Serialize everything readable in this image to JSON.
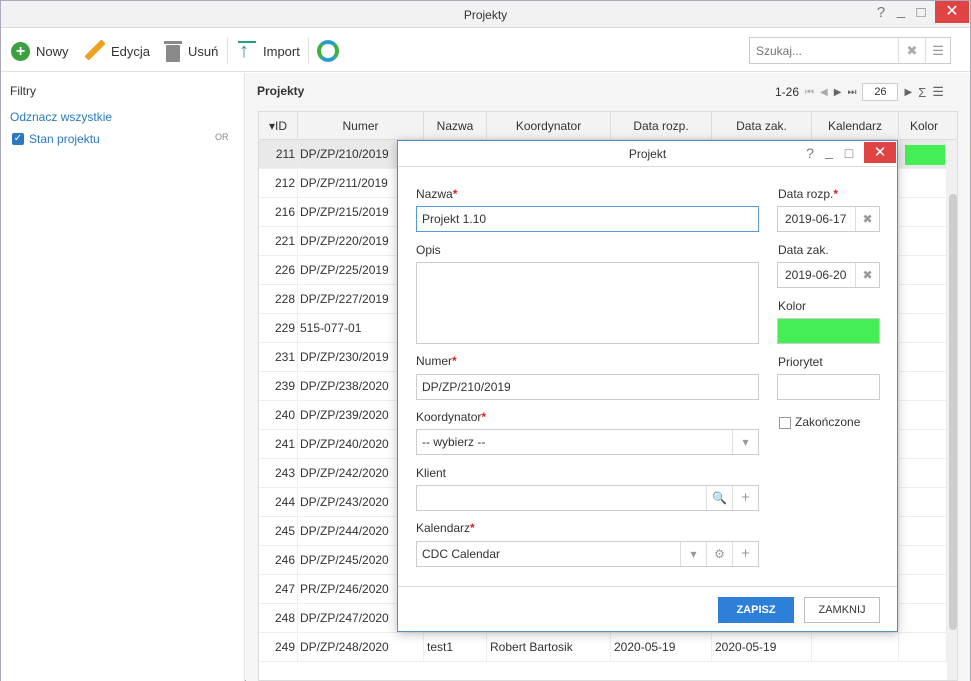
{
  "window": {
    "title": "Projekty",
    "help": "?",
    "minimize": "_",
    "maximize": "□",
    "close": "✕"
  },
  "toolbar": {
    "new_label": "Nowy",
    "edit_label": "Edycja",
    "delete_label": "Usuń",
    "import_label": "Import",
    "search_placeholder": "Szukaj...",
    "search_clear": "✖",
    "search_menu": "☰"
  },
  "filters": {
    "title": "Filtry",
    "uncheck_all": "Odznacz wszystkie",
    "state_label": "Stan projektu",
    "state_checked": true,
    "or_label": "OR"
  },
  "main": {
    "title": "Projekty",
    "pager": {
      "range": "1-26",
      "page_size": "26"
    },
    "columns": [
      "ID",
      "Numer",
      "Nazwa",
      "Koordynator",
      "Data rozp.",
      "Data zak.",
      "Kalendarz",
      "Kolor"
    ],
    "sort_indicator": "▾",
    "rows": [
      {
        "id": "211",
        "numer": "DP/ZP/210/2019",
        "nazwa": "",
        "koordynator": "",
        "data_rozp": "",
        "data_zak": "",
        "kalendarz": "",
        "kolor": "#44ee55"
      },
      {
        "id": "212",
        "numer": "DP/ZP/211/2019",
        "nazwa": "",
        "koordynator": "",
        "data_rozp": "",
        "data_zak": "",
        "kalendarz": "",
        "kolor": ""
      },
      {
        "id": "216",
        "numer": "DP/ZP/215/2019",
        "nazwa": "",
        "koordynator": "",
        "data_rozp": "",
        "data_zak": "",
        "kalendarz": "",
        "kolor": ""
      },
      {
        "id": "221",
        "numer": "DP/ZP/220/2019",
        "nazwa": "",
        "koordynator": "",
        "data_rozp": "",
        "data_zak": "",
        "kalendarz": "",
        "kolor": ""
      },
      {
        "id": "226",
        "numer": "DP/ZP/225/2019",
        "nazwa": "",
        "koordynator": "",
        "data_rozp": "",
        "data_zak": "",
        "kalendarz": "",
        "kolor": ""
      },
      {
        "id": "228",
        "numer": "DP/ZP/227/2019",
        "nazwa": "",
        "koordynator": "",
        "data_rozp": "",
        "data_zak": "",
        "kalendarz": "",
        "kolor": ""
      },
      {
        "id": "229",
        "numer": "515-077-01",
        "nazwa": "",
        "koordynator": "",
        "data_rozp": "",
        "data_zak": "",
        "kalendarz": "",
        "kolor": ""
      },
      {
        "id": "231",
        "numer": "DP/ZP/230/2019",
        "nazwa": "",
        "koordynator": "",
        "data_rozp": "",
        "data_zak": "",
        "kalendarz": "",
        "kolor": ""
      },
      {
        "id": "239",
        "numer": "DP/ZP/238/2020",
        "nazwa": "",
        "koordynator": "",
        "data_rozp": "",
        "data_zak": "",
        "kalendarz": "",
        "kolor": ""
      },
      {
        "id": "240",
        "numer": "DP/ZP/239/2020",
        "nazwa": "",
        "koordynator": "",
        "data_rozp": "",
        "data_zak": "",
        "kalendarz": "",
        "kolor": ""
      },
      {
        "id": "241",
        "numer": "DP/ZP/240/2020",
        "nazwa": "",
        "koordynator": "",
        "data_rozp": "",
        "data_zak": "",
        "kalendarz": "",
        "kolor": ""
      },
      {
        "id": "243",
        "numer": "DP/ZP/242/2020",
        "nazwa": "",
        "koordynator": "",
        "data_rozp": "",
        "data_zak": "",
        "kalendarz": "",
        "kolor": ""
      },
      {
        "id": "244",
        "numer": "DP/ZP/243/2020",
        "nazwa": "",
        "koordynator": "",
        "data_rozp": "",
        "data_zak": "",
        "kalendarz": "",
        "kolor": ""
      },
      {
        "id": "245",
        "numer": "DP/ZP/244/2020",
        "nazwa": "",
        "koordynator": "",
        "data_rozp": "",
        "data_zak": "",
        "kalendarz": "",
        "kolor": ""
      },
      {
        "id": "246",
        "numer": "DP/ZP/245/2020",
        "nazwa": "",
        "koordynator": "",
        "data_rozp": "",
        "data_zak": "",
        "kalendarz": "",
        "kolor": ""
      },
      {
        "id": "247",
        "numer": "PR/ZP/246/2020",
        "nazwa": "",
        "koordynator": "",
        "data_rozp": "",
        "data_zak": "",
        "kalendarz": "",
        "kolor": ""
      },
      {
        "id": "248",
        "numer": "DP/ZP/247/2020",
        "nazwa": "",
        "koordynator": "",
        "data_rozp": "",
        "data_zak": "",
        "kalendarz": "",
        "kolor": ""
      },
      {
        "id": "249",
        "numer": "DP/ZP/248/2020",
        "nazwa": "test1",
        "koordynator": "Robert Bartosik",
        "data_rozp": "2020-05-19",
        "data_zak": "2020-05-19",
        "kalendarz": "",
        "kolor": ""
      }
    ]
  },
  "dialog": {
    "title": "Projekt",
    "help": "?",
    "minimize": "_",
    "maximize": "□",
    "close": "✕",
    "name_label": "Nazwa",
    "name_value": "Projekt 1.10",
    "desc_label": "Opis",
    "desc_value": "",
    "number_label": "Numer",
    "number_value": "DP/ZP/210/2019",
    "coordinator_label": "Koordynator",
    "coordinator_value": "-- wybierz --",
    "client_label": "Klient",
    "client_value": "",
    "calendar_label": "Kalendarz",
    "calendar_value": "CDC Calendar",
    "start_label": "Data rozp.",
    "start_value": "2019-06-17",
    "end_label": "Data zak.",
    "end_value": "2019-06-20",
    "color_label": "Kolor",
    "color_value": "#44ee55",
    "priority_label": "Priorytet",
    "priority_value": "",
    "finished_label": "Zakończone",
    "finished_checked": false,
    "required_mark": "*",
    "save_label": "ZAPISZ",
    "close_label": "ZAMKNIJ"
  }
}
